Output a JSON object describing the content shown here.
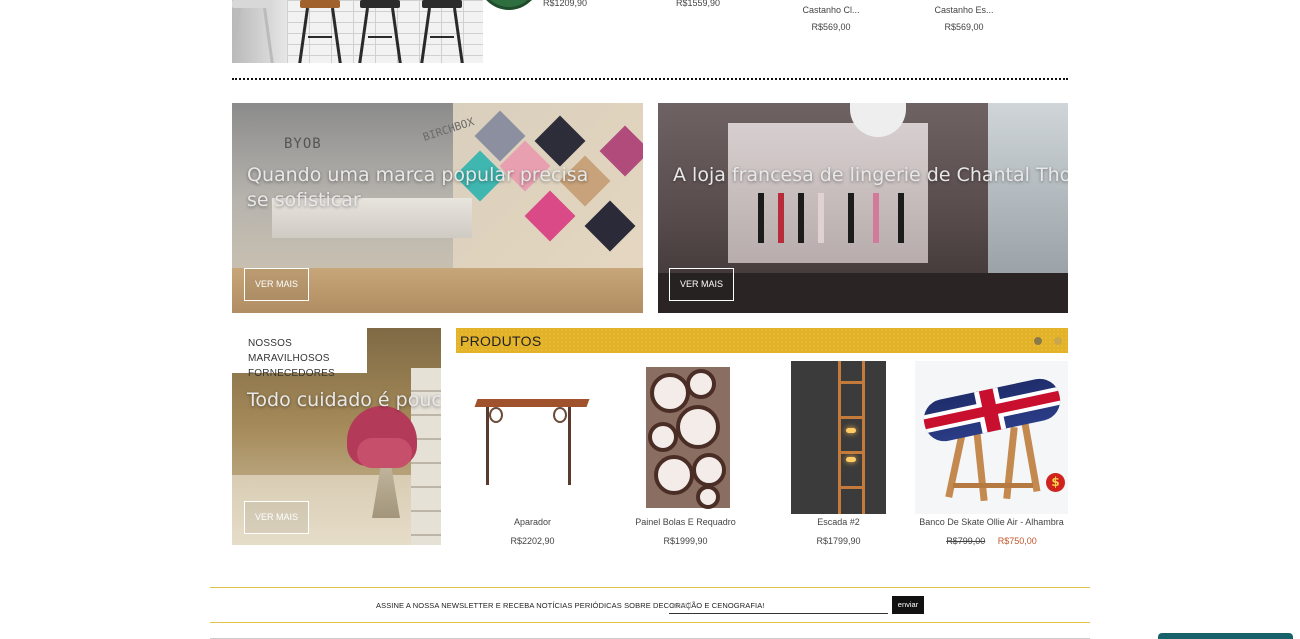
{
  "top_products": [
    {
      "name": "",
      "price": "R$1209,90"
    },
    {
      "name": "",
      "price": "R$1559,90"
    },
    {
      "name": "Castanho Cl...",
      "price": "R$569,00"
    },
    {
      "name": "Castanho Es...",
      "price": "R$569,00"
    }
  ],
  "banners": [
    {
      "title": "Quando uma marca popular precisa se sofisticar",
      "button": "VER MAIS",
      "sign_1": "BYOB",
      "sign_2": "BIRCHBOX"
    },
    {
      "title": "A loja francesa de lingerie de Chantal Thomass",
      "button": "VER MAIS"
    },
    {
      "title": "Todo cuidado é pouco",
      "button": "VER MAIS",
      "tag": "NOSSOS MARAVILHOSOS FORNECEDORES"
    }
  ],
  "produtos": {
    "header": "PRODUTOS",
    "pages": 2,
    "active_page": 1,
    "items": [
      {
        "name": "Aparador",
        "price": "R$2202,90"
      },
      {
        "name": "Painel Bolas E Requadro",
        "price": "R$1999,90"
      },
      {
        "name": "Escada #2",
        "price": "R$1799,90"
      },
      {
        "name": "Banco De Skate Ollie Air - Alhambra",
        "old_price": "R$799,00",
        "price": "R$750,00",
        "sale_badge": "$"
      }
    ]
  },
  "newsletter": {
    "label": "ASSINE A NOSSA NEWSLETTER E RECEBA NOTÍCIAS PERIÓDICAS SOBRE DECORAÇÃO E CENOGRAFIA!",
    "placeholder": "email",
    "button": "enviar"
  },
  "colors": {
    "accent": "#e3b227",
    "sale": "#c0572b",
    "newsletter_border": "#e0c44a",
    "chat": "#17616b"
  }
}
